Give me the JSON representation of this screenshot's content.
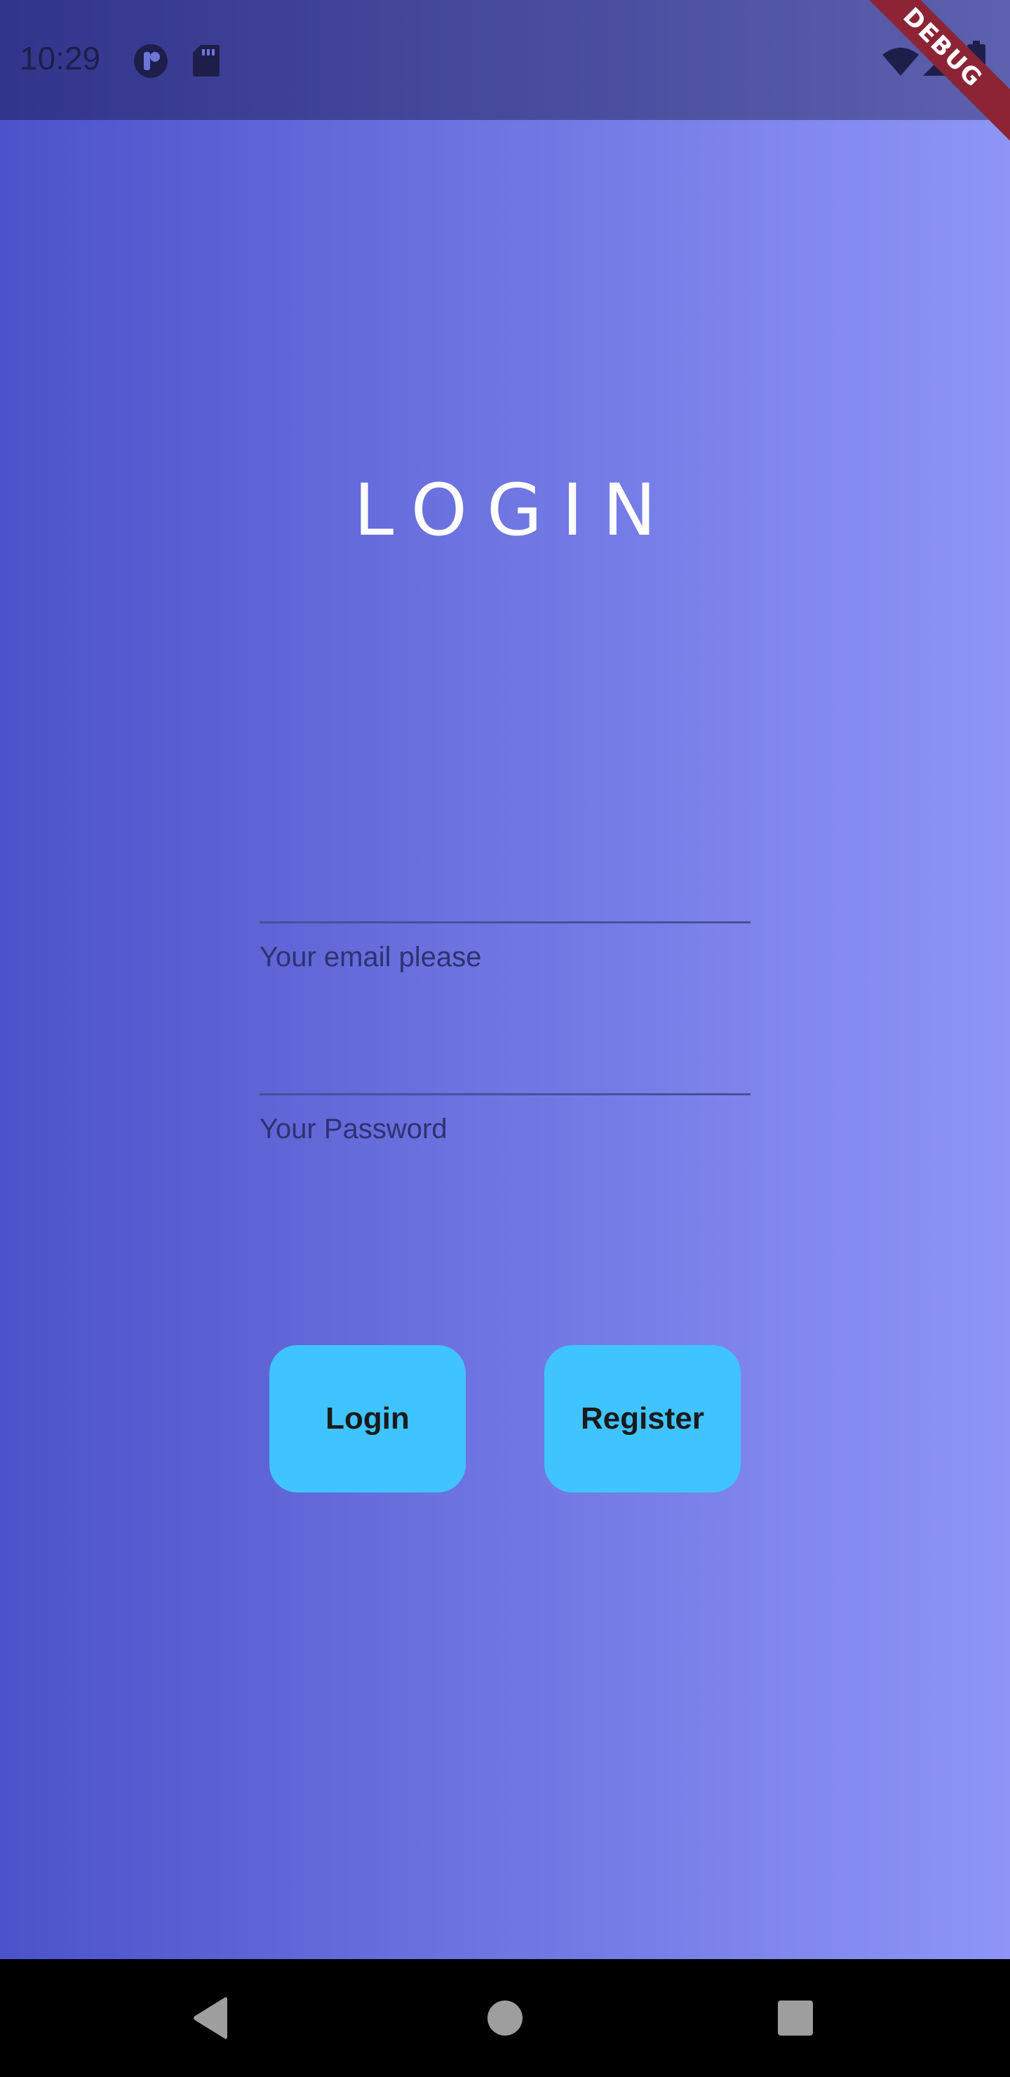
{
  "status_bar": {
    "time": "10:29",
    "icons": [
      "app-notification-icon",
      "sd-card-icon",
      "wifi-icon",
      "cellular-signal-icon",
      "battery-icon"
    ]
  },
  "debug_banner": {
    "label": "DEBUG",
    "color": "#8c2435"
  },
  "page": {
    "title": "LOGIN"
  },
  "form": {
    "email": {
      "label": "Your email please",
      "value": ""
    },
    "password": {
      "label": "Your Password",
      "value": ""
    }
  },
  "buttons": {
    "login_label": "Login",
    "register_label": "Register",
    "color": "#40c4ff"
  },
  "nav_bar": {
    "icons": [
      "back-icon",
      "home-icon",
      "recents-icon"
    ]
  },
  "colors": {
    "gradient_start": "#4c52c9",
    "gradient_end": "#8e95f7",
    "nav_background": "#000000"
  }
}
